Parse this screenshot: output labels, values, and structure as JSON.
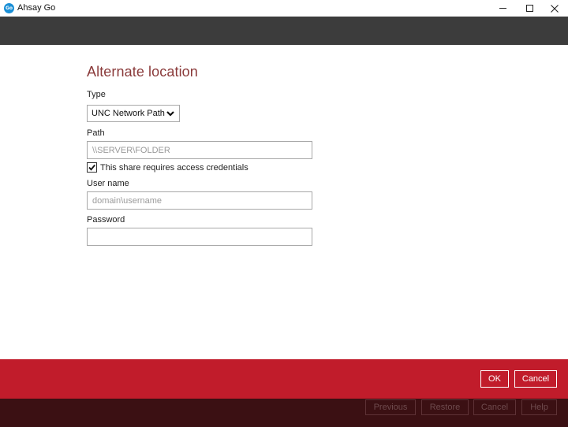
{
  "window": {
    "title": "Ahsay Go",
    "logo_text": "Go",
    "minimize_icon": "minimize-icon",
    "maximize_icon": "maximize-icon",
    "close_icon": "close-icon"
  },
  "form": {
    "title": "Alternate location",
    "type_label": "Type",
    "type_value": "UNC Network Path",
    "path_label": "Path",
    "path_placeholder": "\\\\SERVER\\FOLDER",
    "path_value": "",
    "credentials_checkbox_label": "This share requires access credentials",
    "credentials_checked": true,
    "username_label": "User name",
    "username_placeholder": "domain\\username",
    "username_value": "",
    "password_label": "Password",
    "password_value": ""
  },
  "dialog_actions": {
    "ok_label": "OK",
    "cancel_label": "Cancel"
  },
  "wizard_nav": {
    "previous_label": "Previous",
    "restore_label": "Restore",
    "cancel_label": "Cancel",
    "help_label": "Help"
  },
  "colors": {
    "title_accent": "#8a3a3a",
    "header_dark": "#3c3c3c",
    "action_bar_red": "#c11c2b",
    "footer_dark": "#3b1013"
  }
}
